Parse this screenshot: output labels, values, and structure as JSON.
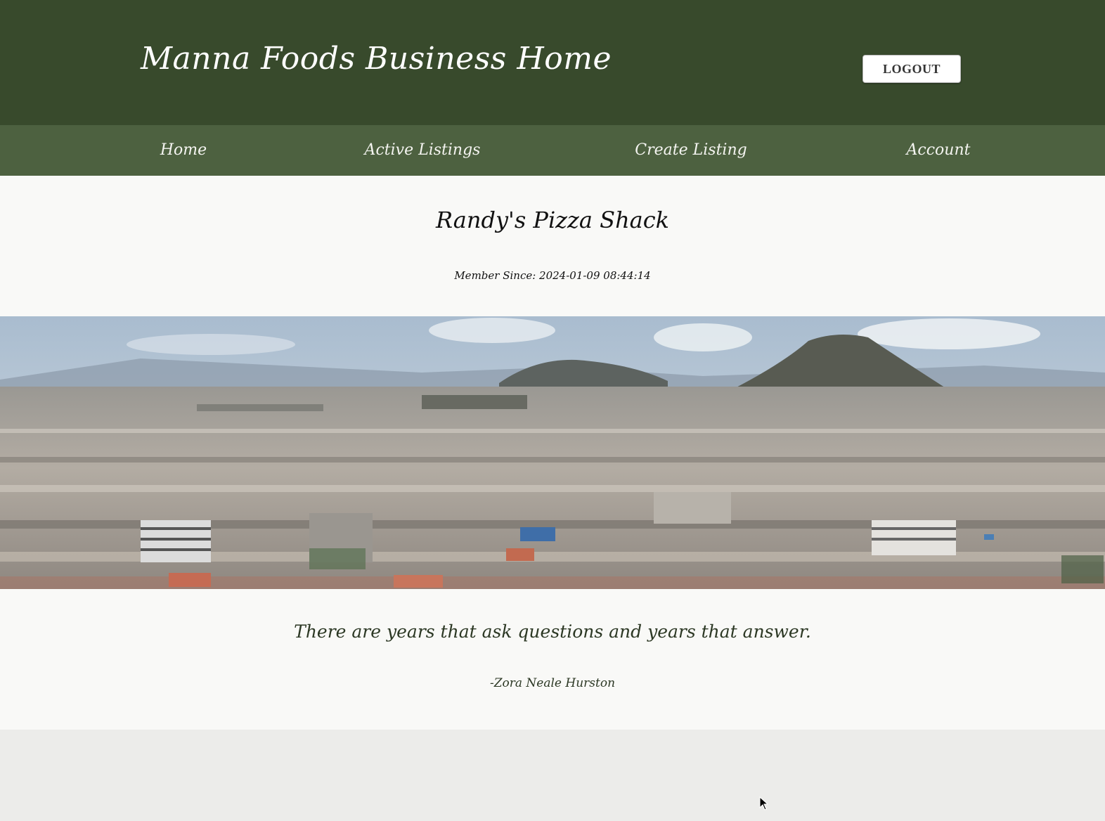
{
  "header": {
    "title": "Manna Foods Business Home",
    "logout_label": "LOGOUT"
  },
  "nav": {
    "items": [
      {
        "label": "Home"
      },
      {
        "label": "Active Listings"
      },
      {
        "label": "Create Listing"
      },
      {
        "label": "Account"
      }
    ]
  },
  "profile": {
    "business_name": "Randy's Pizza Shack",
    "member_since": "Member Since: 2024-01-09 08:44:14"
  },
  "quote": {
    "text": "There are years that ask questions and years that answer.",
    "author": "-Zora Neale Hurston"
  },
  "colors": {
    "header_bg": "#384a2c",
    "nav_bg": "#4d6140",
    "content_bg": "#f9f9f7",
    "quote_text": "#2c3824"
  }
}
